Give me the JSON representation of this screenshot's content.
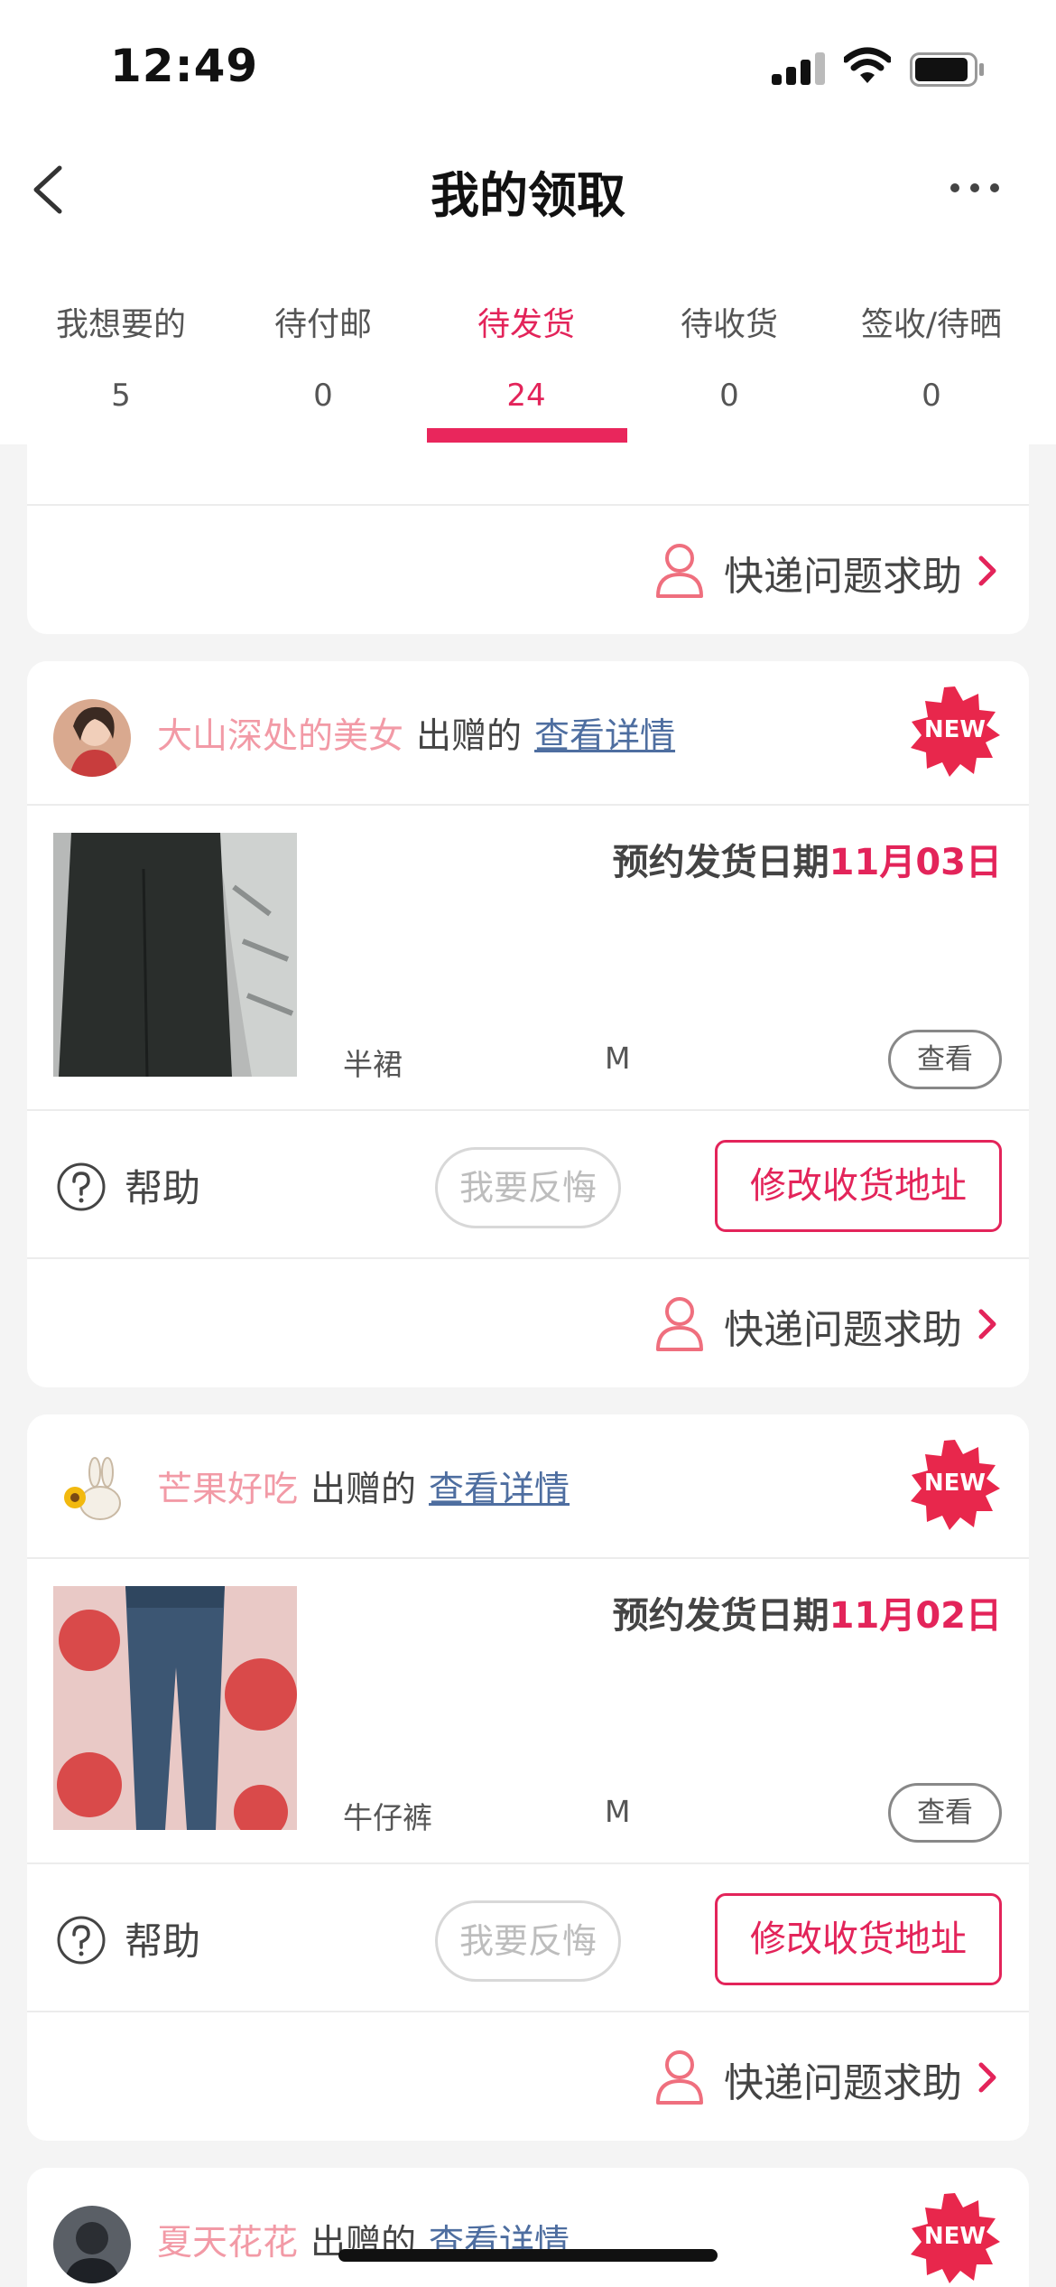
{
  "status_bar": {
    "time": "12:49"
  },
  "header": {
    "title": "我的领取"
  },
  "tabs": [
    {
      "label": "我想要的",
      "count": "5"
    },
    {
      "label": "待付邮",
      "count": "0"
    },
    {
      "label": "待发货",
      "count": "24",
      "active": true
    },
    {
      "label": "待收货",
      "count": "0"
    },
    {
      "label": "签收/待晒",
      "count": "0"
    }
  ],
  "common": {
    "express_help": "快递问题求助",
    "help": "帮助",
    "regret": "我要反悔",
    "modify_address": "修改收货地址",
    "view": "查看",
    "gave": "出赠的",
    "view_details": "查看详情",
    "new_badge": "NEW",
    "ship_date_prefix": "预约发货日期"
  },
  "orders": [
    {
      "giver": "大山深处的美女",
      "ship_date": "11月03日",
      "item": "半裙",
      "size": "M"
    },
    {
      "giver": "芒果好吃",
      "ship_date": "11月02日",
      "item": "牛仔裤",
      "size": "M"
    },
    {
      "giver": "夏天花花"
    }
  ],
  "colors": {
    "accent": "#e3245a",
    "giver_name": "#f29aa6",
    "link": "#4e6ea0",
    "background": "#f4f4f4"
  }
}
